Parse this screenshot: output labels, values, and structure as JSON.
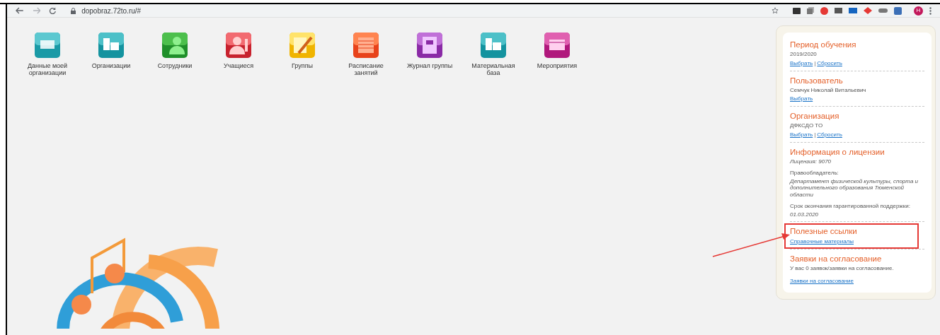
{
  "browser": {
    "url": "dopobraz.72to.ru/#",
    "profile_initial": "Н"
  },
  "tiles": [
    {
      "label": "Данные моей организации",
      "kind": "org"
    },
    {
      "label": "Организации",
      "kind": "orgs"
    },
    {
      "label": "Сотрудники",
      "kind": "staff"
    },
    {
      "label": "Учащиеся",
      "kind": "students"
    },
    {
      "label": "Группы",
      "kind": "groups"
    },
    {
      "label": "Расписание занятий",
      "kind": "schedule"
    },
    {
      "label": "Журнал группы",
      "kind": "journal"
    },
    {
      "label": "Материальная база",
      "kind": "base"
    },
    {
      "label": "Мероприятия",
      "kind": "events"
    }
  ],
  "sidebar": {
    "sections": [
      {
        "title": "Период обучения",
        "lines": [
          {
            "kind": "text",
            "text": "2019/2020"
          },
          {
            "kind": "links",
            "links": [
              "Выбрать",
              "Сбросить"
            ],
            "separator": "|"
          }
        ],
        "highlighted": false
      },
      {
        "title": "Пользователь",
        "lines": [
          {
            "kind": "text",
            "text": "Семчук Николай Витальевич"
          },
          {
            "kind": "links",
            "links": [
              "Выбрать"
            ]
          }
        ],
        "highlighted": false
      },
      {
        "title": "Организация",
        "lines": [
          {
            "kind": "text",
            "text": "ДФКСДО ТО"
          },
          {
            "kind": "links",
            "links": [
              "Выбрать",
              "Сбросить"
            ],
            "separator": "|"
          }
        ],
        "highlighted": false
      },
      {
        "title": "Информация о лицензии",
        "lines": [
          {
            "kind": "italic",
            "text": "Лицензия: 9070"
          },
          {
            "kind": "label",
            "text": "Правообладатель:"
          },
          {
            "kind": "italic",
            "text": "Департамент физической культуры, спорта и дополнительного образования Тюменской области"
          },
          {
            "kind": "label",
            "text": "Срок окончания гарантированной поддержки:"
          },
          {
            "kind": "italic",
            "text": "01.03.2020"
          }
        ],
        "highlighted": false
      },
      {
        "title": "Полезные ссылки",
        "lines": [
          {
            "kind": "links",
            "links": [
              "Справочные материалы"
            ]
          }
        ],
        "highlighted": true
      },
      {
        "title": "Заявки на согласование",
        "lines": [
          {
            "kind": "text",
            "text": "У вас 0 заявок/заявки на согласование."
          },
          {
            "kind": "spaced_links",
            "links": [
              "Заявки на согласование"
            ]
          }
        ],
        "highlighted": false
      }
    ]
  }
}
